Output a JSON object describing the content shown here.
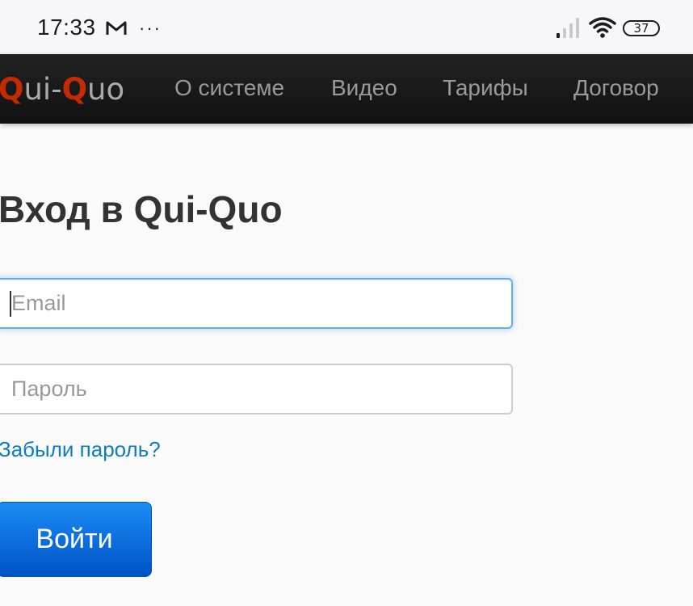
{
  "status_bar": {
    "time": "17:33",
    "more": "···",
    "battery": "37",
    "icons": [
      "gmail-icon",
      "signal-icon",
      "wifi-icon",
      "battery-icon"
    ]
  },
  "navbar": {
    "logo": {
      "q1": "Q",
      "part1": "ui-",
      "q2": "Q",
      "part2": "uo"
    },
    "items": [
      {
        "label": "О системе"
      },
      {
        "label": "Видео"
      },
      {
        "label": "Тарифы"
      },
      {
        "label": "Договор"
      }
    ]
  },
  "login": {
    "title": "Вход в Qui-Quo",
    "email_placeholder": "Email",
    "email_value": "",
    "password_placeholder": "Пароль",
    "password_value": "",
    "forgot_label": "Забыли пароль?",
    "submit_label": "Войти"
  },
  "colors": {
    "brand_red": "#c42b04",
    "link_blue": "#0a7fbf",
    "button_blue": "#0a6fe0",
    "focus_blue": "#66afe9",
    "navbar_bg": "#1a1a1a"
  }
}
